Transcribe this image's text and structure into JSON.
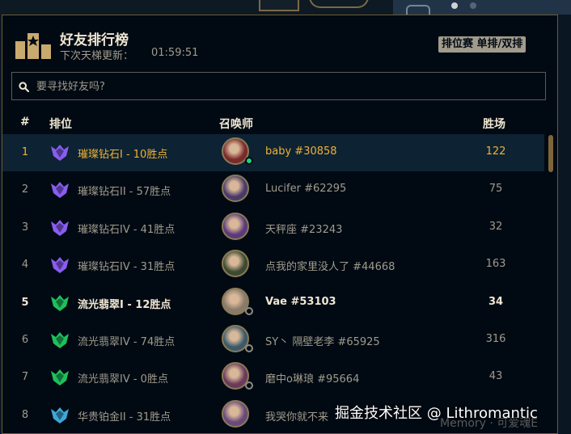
{
  "panel": {
    "title": "好友排行榜",
    "subtitle": "下次天梯更新：",
    "timer": "01:59:51",
    "queue_badge": "排位赛 单排/双排"
  },
  "search": {
    "placeholder": "要寻找好友吗?"
  },
  "columns": {
    "num": "#",
    "rank": "排位",
    "summoner": "召唤师",
    "games": "胜场"
  },
  "rows": [
    {
      "no": "1",
      "rank": "璀璨钻石I - 10胜点",
      "tier": "diamond",
      "name": "baby #30858",
      "games": "122",
      "status": "online",
      "state": "selected"
    },
    {
      "no": "2",
      "rank": "璀璨钻石II - 57胜点",
      "tier": "diamond",
      "name": "Lucifer #62295",
      "games": "75",
      "status": "none",
      "state": "normal"
    },
    {
      "no": "3",
      "rank": "璀璨钻石IV - 41胜点",
      "tier": "diamond",
      "name": "天秤座 #23243",
      "games": "32",
      "status": "none",
      "state": "normal"
    },
    {
      "no": "4",
      "rank": "璀璨钻石IV - 31胜点",
      "tier": "diamond",
      "name": "点我的家里没人了 #44668",
      "games": "163",
      "status": "none",
      "state": "normal"
    },
    {
      "no": "5",
      "rank": "流光翡翠I - 12胜点",
      "tier": "emerald",
      "name": "Vae #53103",
      "games": "34",
      "status": "offline",
      "state": "bold"
    },
    {
      "no": "6",
      "rank": "流光翡翠IV - 74胜点",
      "tier": "emerald",
      "name": "SY丶 隔壁老李 #65925",
      "games": "316",
      "status": "offline",
      "state": "normal"
    },
    {
      "no": "7",
      "rank": "流光翡翠IV - 0胜点",
      "tier": "emerald",
      "name": "磨中o琳琅 #95664",
      "games": "43",
      "status": "offline",
      "state": "normal"
    },
    {
      "no": "8",
      "rank": "华贵铂金II - 31胜点",
      "tier": "platinum",
      "name": "我哭你就不来",
      "games": "",
      "status": "none",
      "state": "normal"
    }
  ],
  "colors": {
    "diamond": "#8a5cf0",
    "emerald": "#1fbf5a",
    "platinum": "#3fa7d6",
    "selected_text": "#f0b232"
  },
  "watermark": "掘金技术社区 @ Lithromantic",
  "partial_bottom_text": "Memory · 可爱魂E"
}
